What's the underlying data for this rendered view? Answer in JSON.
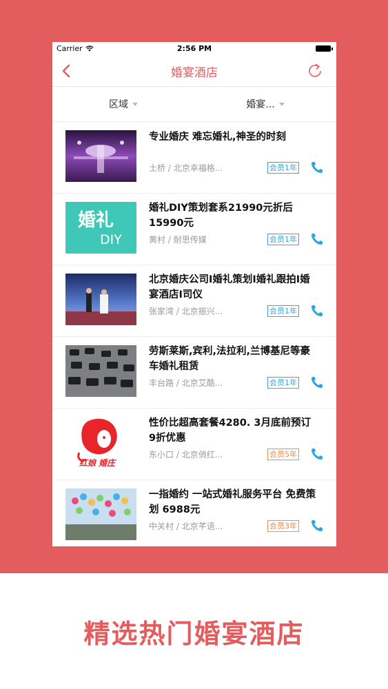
{
  "status_bar": {
    "carrier": "Carrier",
    "time": "2:56 PM"
  },
  "nav": {
    "title": "婚宴酒店",
    "back_icon": "chevron-left-icon",
    "refresh_icon": "refresh-icon"
  },
  "filters": [
    {
      "label": "区域"
    },
    {
      "label": "婚宴..."
    }
  ],
  "items": [
    {
      "title": "专业婚庆 难忘婚礼,神圣的时刻",
      "area": "土桥",
      "vendor": "北京幸福格...",
      "badge": "会员1年",
      "badge_color": "#3aa3de"
    },
    {
      "title": "婚礼DIY策划套系21990元折后15990元",
      "area": "黄村",
      "vendor": "耐思传媒",
      "badge": "会员1年",
      "badge_color": "#3aa3de",
      "thumb_text_top": "婚礼",
      "thumb_text_bottom": "DIY"
    },
    {
      "title": "北京婚庆公司I婚礼策划I婚礼跟拍I婚宴酒店I司仪",
      "area": "张家湾",
      "vendor": "北京振兴...",
      "badge": "会员1年",
      "badge_color": "#3aa3de"
    },
    {
      "title": "劳斯莱斯,宾利,法拉利,兰博基尼等豪车婚礼租赁",
      "area": "丰台路",
      "vendor": "北京艾酷...",
      "badge": "会员1年",
      "badge_color": "#3aa3de"
    },
    {
      "title": "性价比超高套餐4280. 3月底前预订 9折优惠",
      "area": "东小口",
      "vendor": "北京俏红...",
      "badge": "会员5年",
      "badge_color": "#f28a4b",
      "thumb_text": "红娘 婚庄"
    },
    {
      "title": "一指婚约 一站式婚礼服务平台 免费策划 6988元",
      "area": "中关村",
      "vendor": "北京芊语...",
      "badge": "会员3年",
      "badge_color": "#f28a4b"
    }
  ],
  "promo": {
    "text": "精选热门婚宴酒店"
  },
  "colors": {
    "brand": "#e35d5f",
    "badge_blue": "#3aa3de",
    "badge_orange": "#f28a4b",
    "phone_icon": "#2aa7e0"
  }
}
